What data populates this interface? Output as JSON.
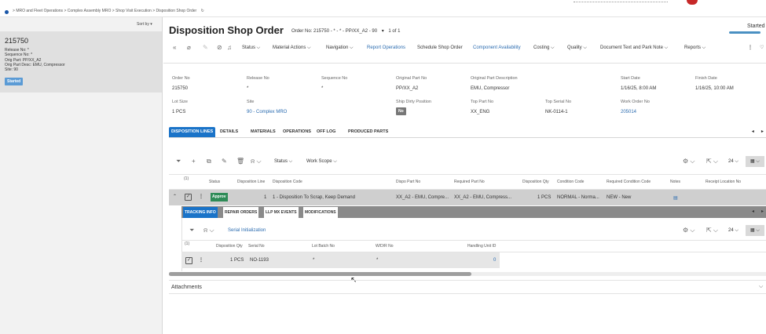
{
  "breadcrumb": {
    "items": [
      "MRO and Fleet Operations",
      "Complex Assembly MRO",
      "Shop Visit Execution",
      "Disposition Shop Order"
    ],
    "separator": ">"
  },
  "sidebar": {
    "sort_label": "Sort by",
    "card": {
      "title": "215750",
      "release_label": "Release No:",
      "release_value": "*",
      "sequence_label": "Sequence No:",
      "sequence_value": "*",
      "orig_part_label": "Orig Part:",
      "orig_part_value": "PP/XX_A2",
      "orig_desc_label": "Orig Part Desc:",
      "orig_desc_value": "EMU, Compressor",
      "site_label": "Site:",
      "site_value": "90",
      "status_badge": "Started"
    }
  },
  "header": {
    "title": "Disposition Shop Order",
    "order_ref": "Order No: 215750 - * - * - PP/XX_A2 - 90",
    "pager": "1 of 1",
    "status_top_right": "Started"
  },
  "toolbar": {
    "status": "Status",
    "material_actions": "Material Actions",
    "navigation": "Navigation",
    "report_operations": "Report Operations",
    "schedule_shop_order": "Schedule Shop Order",
    "component_availability": "Component Availability",
    "costing": "Costing",
    "quality": "Quality",
    "document_text": "Document Text and Park Note",
    "reports": "Reports"
  },
  "fields": {
    "order_no": {
      "label": "Order No",
      "value": "215750"
    },
    "release_no": {
      "label": "Release No",
      "value": "*"
    },
    "sequence_no": {
      "label": "Sequence No",
      "value": "*"
    },
    "original_part_no": {
      "label": "Original Part No",
      "value": "PP/XX_A2"
    },
    "original_part_desc": {
      "label": "Original Part Description",
      "value": "EMU, Compressor"
    },
    "start_date": {
      "label": "Start Date",
      "value": "1/16/25, 8:00 AM"
    },
    "finish_date": {
      "label": "Finish Date",
      "value": "1/16/25, 10:00 AM"
    },
    "lot_size": {
      "label": "Lot Size",
      "value": "1 PCS"
    },
    "site": {
      "label": "Site",
      "value": "90 - Complex MRO"
    },
    "ship_dirty": {
      "label": "Ship Dirty Position",
      "value": "No"
    },
    "top_part_no": {
      "label": "Top Part No",
      "value": "XX_ENG"
    },
    "top_serial_no": {
      "label": "Top Serial No",
      "value": "NK-0114-1"
    },
    "work_order_no": {
      "label": "Work Order No",
      "value": "205014"
    }
  },
  "tabs": [
    "DISPOSITION LINES",
    "DETAILS",
    "MATERIALS",
    "OPERATIONS",
    "OFF LOG",
    "PRODUCED PARTS"
  ],
  "grid_toolbar": {
    "status": "Status",
    "work_scope": "Work Scope",
    "page_size": "24"
  },
  "grid": {
    "columns": [
      "Status",
      "Disposition Line",
      "Disposition Code",
      "Dispo Part No",
      "Required Part No",
      "Disposition Qty",
      "Condition Code",
      "Required Condition Code",
      "Notes",
      "Receipt Location No"
    ],
    "count_badge": "(1)",
    "row": {
      "status": "Approv",
      "line": "1",
      "code": "1 - Disposition To Scrap, Keep Demand",
      "dispo_part": "XX_A2 - EMU, Compre...",
      "required_part": "XX_A2 - EMU, Compress...",
      "qty": "1 PCS",
      "condition": "NORMAL - Norma...",
      "req_condition": "NEW - New"
    }
  },
  "subtabs": [
    "TRACKING INFO",
    "REPAIR ORDERS",
    "LLP MX EVENTS",
    "MODIFICATIONS"
  ],
  "subgrid": {
    "action": "Serial Initialization",
    "page_size": "24",
    "count_badge": "(1)",
    "columns": [
      "Disposition Qty",
      "Serial No",
      "Lot Batch No",
      "W/D/R No",
      "Handling Unit ID"
    ],
    "row": {
      "qty": "1 PCS",
      "serial": "NO-1193",
      "lot": "*",
      "wdr": "*",
      "handling": "0"
    }
  },
  "attachments": "Attachments",
  "colors": {
    "accent": "#1a73c8",
    "badge": "#5b9bd5",
    "approved": "#2e8b57"
  }
}
